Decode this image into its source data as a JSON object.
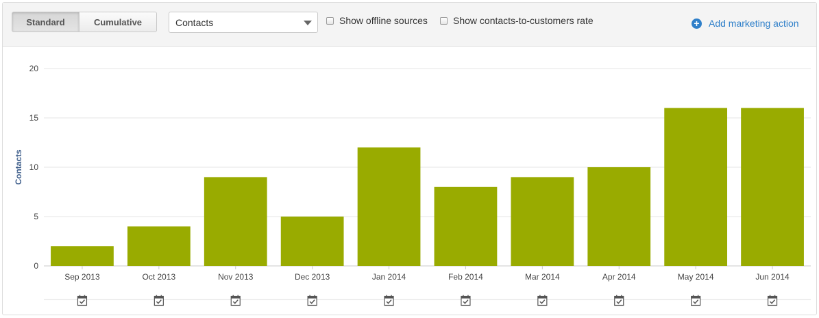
{
  "toolbar": {
    "mode_standard": "Standard",
    "mode_cumulative": "Cumulative",
    "selected_metric": "Contacts",
    "offline_label": "Show offline sources",
    "rate_label": "Show contacts-to-customers rate",
    "add_action_label": "Add marketing action",
    "accent_color": "#2e7fc9"
  },
  "chart_data": {
    "type": "bar",
    "categories": [
      "Sep 2013",
      "Oct 2013",
      "Nov 2013",
      "Dec 2013",
      "Jan 2014",
      "Feb 2014",
      "Mar 2014",
      "Apr 2014",
      "May 2014",
      "Jun 2014"
    ],
    "values": [
      2,
      4,
      9,
      5,
      12,
      8,
      9,
      10,
      16,
      16
    ],
    "ylabel": "Contacts",
    "ylim": [
      0,
      20
    ],
    "yticks": [
      0,
      5,
      10,
      15,
      20
    ],
    "bar_color": "#99ab00",
    "grid": true,
    "legend": "none"
  },
  "icons": {
    "action_marker": "calendar-check-icon"
  }
}
